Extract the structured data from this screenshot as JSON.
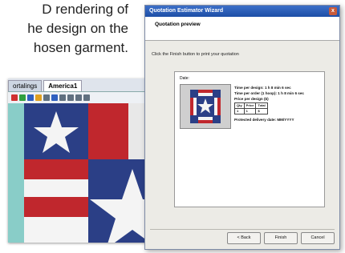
{
  "caption": {
    "line1": "D rendering of",
    "line2": "he design on the",
    "line3": "hosen garment."
  },
  "app": {
    "tabs": [
      {
        "label": "ortalings"
      },
      {
        "label": "America1"
      }
    ]
  },
  "wizard": {
    "title": "Quotation Estimator Wizard",
    "close_glyph": "x",
    "header": "Quotation preview",
    "instruction": "Click the Finish button to print your quotation",
    "preview_label": "Date:",
    "info": {
      "line1": "Time per design: 1 h 8 min 6 sec",
      "line2": "Time per order (1 hoop): 1 h 8 min 6 sec",
      "line3": "Price per design ($)",
      "table_headers": [
        "Qty",
        "Price",
        "Total"
      ],
      "table_values": [
        "1",
        "1",
        "$"
      ],
      "line4": "Protected delivery date: MM/YYYY"
    },
    "buttons": {
      "back": "< Back",
      "finish": "Finish",
      "cancel": "Cancel"
    }
  },
  "colors": {
    "title_bar": "#1d4ea6",
    "canvas_bg": "#89cdc8",
    "flag_red": "#c0272d",
    "flag_blue": "#2b3f86",
    "flag_white": "#f4f4f4"
  }
}
